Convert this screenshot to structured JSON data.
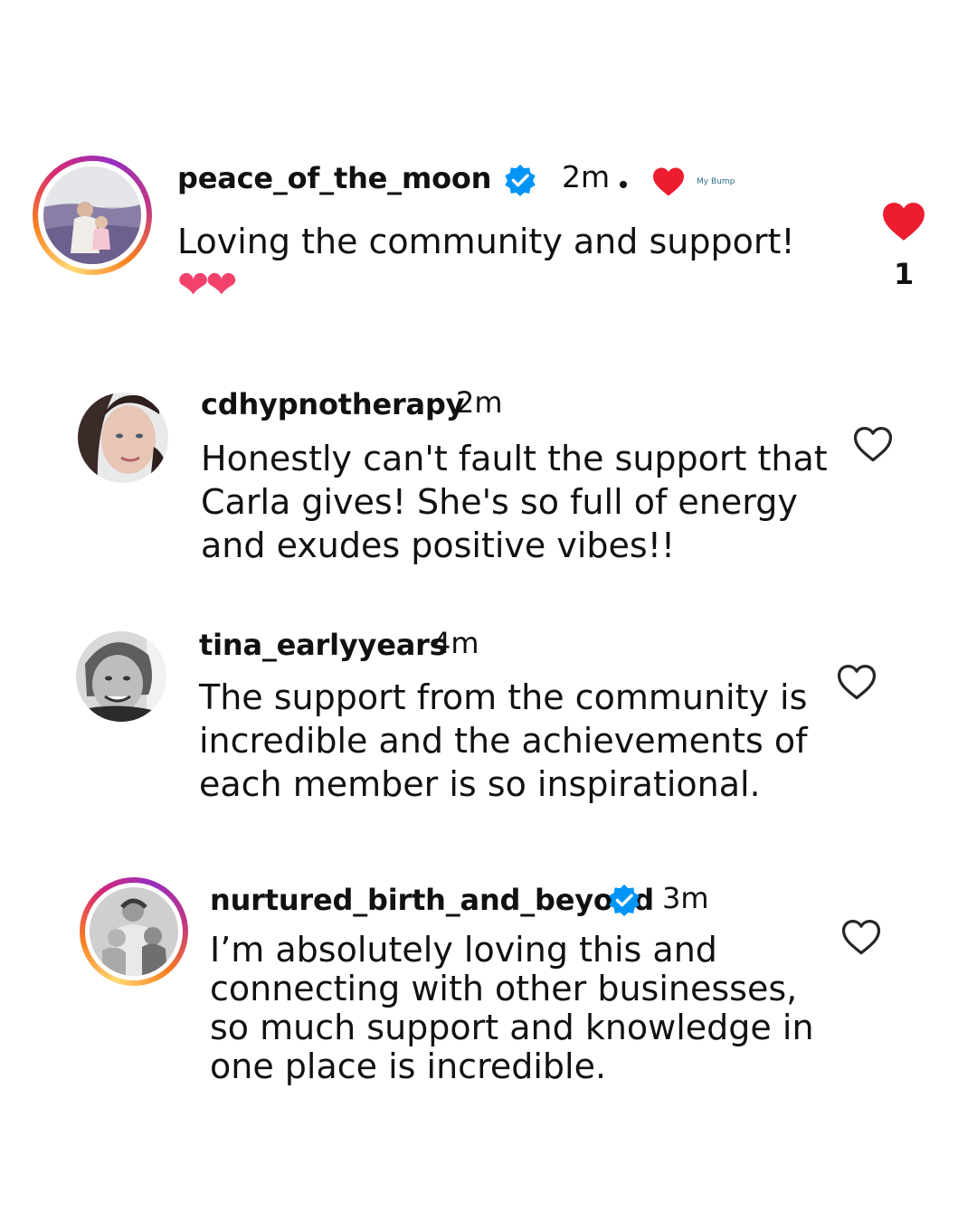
{
  "comments": [
    {
      "username": "peace_of_the_moon",
      "verified": true,
      "time": "2m",
      "text": "Loving the community and support!",
      "emoji": "❤❤",
      "liked": true,
      "like_count": "1",
      "liked_by_creator_logo": "My Bump"
    },
    {
      "username": "cdhypnotherapy",
      "verified": false,
      "time": "2m",
      "text": "Honestly can't fault the support that\nCarla gives! She's so full of energy\nand exudes positive vibes!!",
      "liked": false
    },
    {
      "username": "tina_earlyyears",
      "verified": false,
      "time": "4m",
      "text": "The support from the community is\nincredible and the achievements of\neach member is so inspirational.",
      "liked": false
    },
    {
      "username": "nurtured_birth_and_beyond",
      "verified": true,
      "time": "3m",
      "text": "I’m absolutely loving this and\nconnecting with other businesses,\nso much support and knowledge in\none place is incredible.",
      "liked": false
    }
  ],
  "colors": {
    "like_red": "#ed1c2e",
    "verified_blue": "#0095f6",
    "emoji_pink": "#f2426b"
  }
}
